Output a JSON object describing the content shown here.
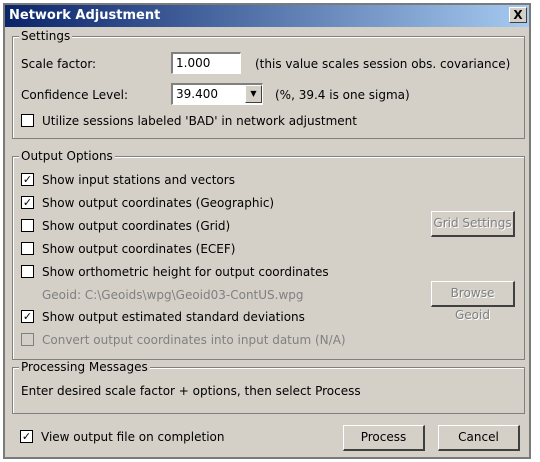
{
  "window": {
    "title": "Network Adjustment",
    "close_label": "X"
  },
  "settings": {
    "legend": "Settings",
    "scale_factor_label": "Scale factor:",
    "scale_factor_value": "1.000",
    "scale_factor_hint": "(this value scales session obs. covariance)",
    "confidence_label": "Confidence Level:",
    "confidence_value": "39.400",
    "confidence_hint": "(%, 39.4 is one sigma)",
    "utilize_bad_label": "Utilize sessions labeled 'BAD' in network adjustment",
    "utilize_bad_checked": false
  },
  "output": {
    "legend": "Output Options",
    "options": [
      {
        "label": "Show input stations and vectors",
        "checked": true
      },
      {
        "label": "Show output coordinates (Geographic)",
        "checked": true
      },
      {
        "label": "Show output coordinates (Grid)",
        "checked": false
      },
      {
        "label": "Show output coordinates (ECEF)",
        "checked": false
      },
      {
        "label": "Show orthometric height for output coordinates",
        "checked": false
      }
    ],
    "geoid_text": "Geoid: C:\\Geoids\\wpg\\Geoid03-ContUS.wpg",
    "std_dev_label": "Show output estimated standard deviations",
    "std_dev_checked": true,
    "convert_label": "Convert output coordinates into input datum (N/A)",
    "convert_checked": false,
    "grid_settings_label": "Grid Settings",
    "browse_geoid_label": "Browse Geoid"
  },
  "messages": {
    "legend": "Processing Messages",
    "text": "Enter desired scale factor + options, then select Process"
  },
  "footer": {
    "view_output_label": "View output file on completion",
    "view_output_checked": true,
    "process_label": "Process",
    "cancel_label": "Cancel"
  }
}
